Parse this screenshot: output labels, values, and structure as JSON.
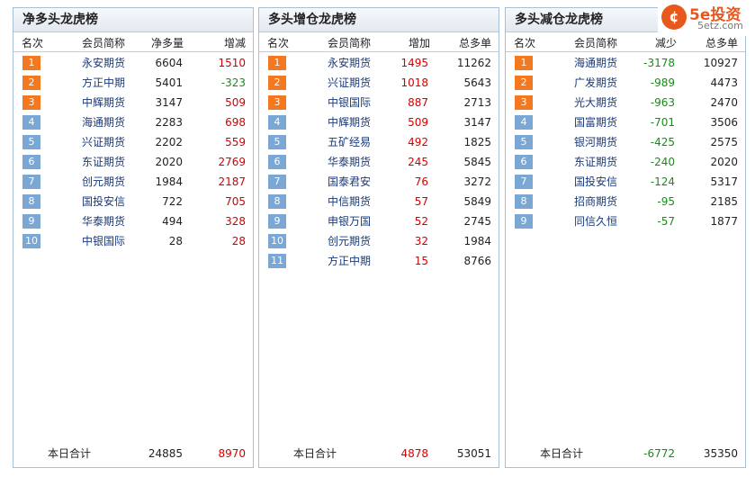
{
  "logo": {
    "main": "5e投资",
    "sub": "5etz.com",
    "icon": "¢"
  },
  "panels": [
    {
      "title": "净多头龙虎榜",
      "headers": [
        "名次",
        "会员简称",
        "净多量",
        "增减"
      ],
      "rows": [
        {
          "rank": "1",
          "name": "永安期货",
          "v1": "6604",
          "v2": "1510"
        },
        {
          "rank": "2",
          "name": "方正中期",
          "v1": "5401",
          "v2": "-323"
        },
        {
          "rank": "3",
          "name": "中辉期货",
          "v1": "3147",
          "v2": "509"
        },
        {
          "rank": "4",
          "name": "海通期货",
          "v1": "2283",
          "v2": "698"
        },
        {
          "rank": "5",
          "name": "兴证期货",
          "v1": "2202",
          "v2": "559"
        },
        {
          "rank": "6",
          "name": "东证期货",
          "v1": "2020",
          "v2": "2769"
        },
        {
          "rank": "7",
          "name": "创元期货",
          "v1": "1984",
          "v2": "2187"
        },
        {
          "rank": "8",
          "name": "国投安信",
          "v1": "722",
          "v2": "705"
        },
        {
          "rank": "9",
          "name": "华泰期货",
          "v1": "494",
          "v2": "328"
        },
        {
          "rank": "10",
          "name": "中银国际",
          "v1": "28",
          "v2": "28"
        }
      ],
      "total": {
        "label": "本日合计",
        "v1": "24885",
        "v2": "8970"
      }
    },
    {
      "title": "多头增仓龙虎榜",
      "headers": [
        "名次",
        "会员简称",
        "增加",
        "总多单"
      ],
      "rows": [
        {
          "rank": "1",
          "name": "永安期货",
          "v1": "1495",
          "v2": "11262"
        },
        {
          "rank": "2",
          "name": "兴证期货",
          "v1": "1018",
          "v2": "5643"
        },
        {
          "rank": "3",
          "name": "中银国际",
          "v1": "887",
          "v2": "2713"
        },
        {
          "rank": "4",
          "name": "中辉期货",
          "v1": "509",
          "v2": "3147"
        },
        {
          "rank": "5",
          "name": "五矿经易",
          "v1": "492",
          "v2": "1825"
        },
        {
          "rank": "6",
          "name": "华泰期货",
          "v1": "245",
          "v2": "5845"
        },
        {
          "rank": "7",
          "name": "国泰君安",
          "v1": "76",
          "v2": "3272"
        },
        {
          "rank": "8",
          "name": "中信期货",
          "v1": "57",
          "v2": "5849"
        },
        {
          "rank": "9",
          "name": "申银万国",
          "v1": "52",
          "v2": "2745"
        },
        {
          "rank": "10",
          "name": "创元期货",
          "v1": "32",
          "v2": "1984"
        },
        {
          "rank": "11",
          "name": "方正中期",
          "v1": "15",
          "v2": "8766"
        }
      ],
      "total": {
        "label": "本日合计",
        "v1": "4878",
        "v2": "53051"
      }
    },
    {
      "title": "多头减仓龙虎榜",
      "headers": [
        "名次",
        "会员简称",
        "减少",
        "总多单"
      ],
      "rows": [
        {
          "rank": "1",
          "name": "海通期货",
          "v1": "-3178",
          "v2": "10927"
        },
        {
          "rank": "2",
          "name": "广发期货",
          "v1": "-989",
          "v2": "4473"
        },
        {
          "rank": "3",
          "name": "光大期货",
          "v1": "-963",
          "v2": "2470"
        },
        {
          "rank": "4",
          "name": "国富期货",
          "v1": "-701",
          "v2": "3506"
        },
        {
          "rank": "5",
          "name": "银河期货",
          "v1": "-425",
          "v2": "2575"
        },
        {
          "rank": "6",
          "name": "东证期货",
          "v1": "-240",
          "v2": "2020"
        },
        {
          "rank": "7",
          "name": "国投安信",
          "v1": "-124",
          "v2": "5317"
        },
        {
          "rank": "8",
          "name": "招商期货",
          "v1": "-95",
          "v2": "2185"
        },
        {
          "rank": "9",
          "name": "同信久恒",
          "v1": "-57",
          "v2": "1877"
        }
      ],
      "total": {
        "label": "本日合计",
        "v1": "-6772",
        "v2": "35350"
      }
    }
  ]
}
